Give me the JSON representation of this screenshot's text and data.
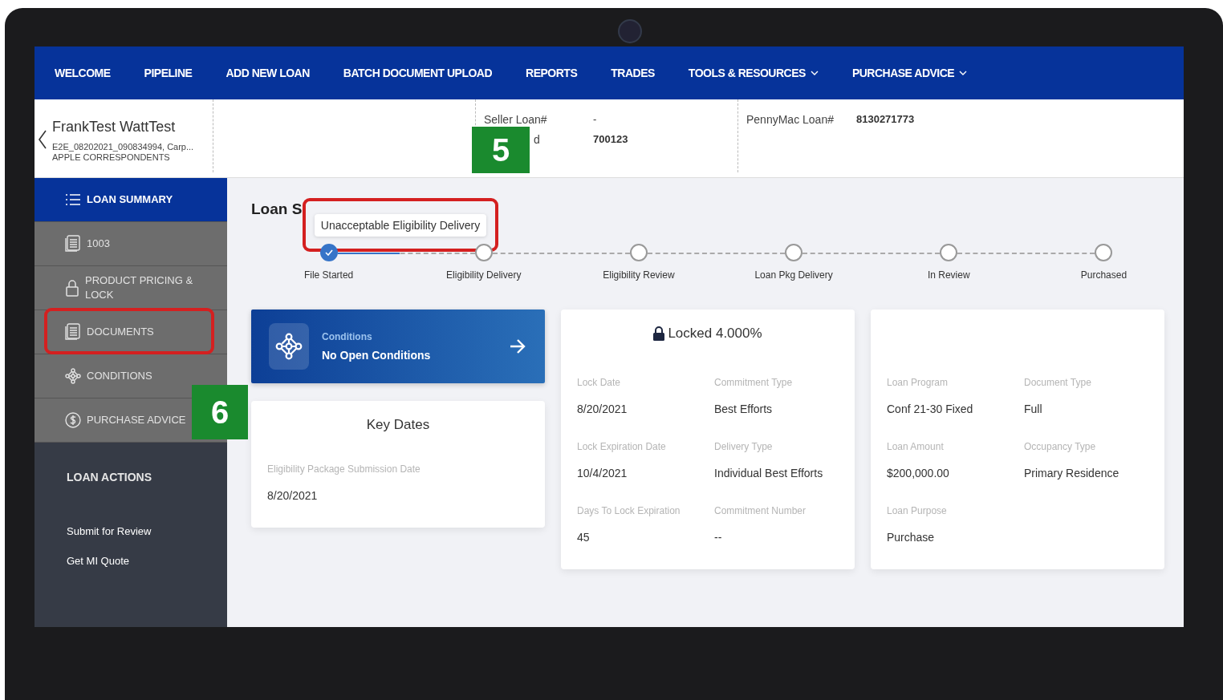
{
  "nav": {
    "items": [
      {
        "label": "WELCOME",
        "dropdown": false
      },
      {
        "label": "PIPELINE",
        "dropdown": false
      },
      {
        "label": "ADD NEW LOAN",
        "dropdown": false
      },
      {
        "label": "BATCH DOCUMENT UPLOAD",
        "dropdown": false
      },
      {
        "label": "REPORTS",
        "dropdown": false
      },
      {
        "label": "TRADES",
        "dropdown": false
      },
      {
        "label": "TOOLS & RESOURCES",
        "dropdown": true
      },
      {
        "label": "PURCHASE ADVICE",
        "dropdown": true
      }
    ]
  },
  "header": {
    "borrower": "FrankTest WattTest",
    "loan_line": "E2E_08202021_090834994, Carp...",
    "company": "APPLE CORRESPONDENTS",
    "fields": [
      {
        "label": "Seller Loan#",
        "value": "-"
      },
      {
        "label": "d",
        "value": "700123"
      }
    ],
    "pennymac": {
      "label": "PennyMac Loan#",
      "value": "8130271773"
    }
  },
  "sidebar": {
    "items": [
      {
        "label": "LOAN SUMMARY",
        "kind": "list",
        "selected": true,
        "highlighted": false
      },
      {
        "label": "1003",
        "kind": "doc",
        "selected": false,
        "highlighted": false
      },
      {
        "label": "PRODUCT PRICING & LOCK",
        "kind": "lock",
        "selected": false,
        "highlighted": false
      },
      {
        "label": "DOCUMENTS",
        "kind": "doc",
        "selected": false,
        "highlighted": true
      },
      {
        "label": "CONDITIONS",
        "kind": "network",
        "selected": false,
        "highlighted": false
      },
      {
        "label": "PURCHASE ADVICE",
        "kind": "dollar",
        "selected": false,
        "highlighted": false
      }
    ],
    "actions_title": "LOAN ACTIONS",
    "actions": [
      "Submit for Review",
      "Get MI Quote"
    ]
  },
  "main": {
    "title": "Loan S",
    "tooltip": "Unacceptable Eligibility Delivery",
    "steps": [
      {
        "label": "File Started",
        "completed": true
      },
      {
        "label": "Eligibility Delivery",
        "completed": false
      },
      {
        "label": "Eligibility Review",
        "completed": false
      },
      {
        "label": "Loan Pkg Delivery",
        "completed": false
      },
      {
        "label": "In Review",
        "completed": false
      },
      {
        "label": "Purchased",
        "completed": false
      }
    ],
    "conditions": {
      "label": "Conditions",
      "value": "No Open Conditions"
    },
    "key_dates": {
      "title": "Key Dates",
      "fields": [
        {
          "label": "Eligibility Package Submission Date",
          "value": "8/20/2021"
        }
      ]
    },
    "lock_card": {
      "status": "Locked 4.000%",
      "fields": [
        {
          "label": "Lock Date",
          "value": "8/20/2021"
        },
        {
          "label": "Commitment Type",
          "value": "Best Efforts"
        },
        {
          "label": "Lock Expiration Date",
          "value": "10/4/2021"
        },
        {
          "label": "Delivery Type",
          "value": "Individual Best Efforts"
        },
        {
          "label": "Days To Lock Expiration",
          "value": "45"
        },
        {
          "label": "Commitment Number",
          "value": "--"
        }
      ]
    },
    "loan_card": {
      "fields": [
        {
          "label": "Loan Program",
          "value": "Conf 21-30 Fixed"
        },
        {
          "label": "Document Type",
          "value": "Full"
        },
        {
          "label": "Loan Amount",
          "value": "$200,000.00"
        },
        {
          "label": "Occupancy Type",
          "value": "Primary Residence"
        },
        {
          "label": "Loan Purpose",
          "value": "Purchase"
        }
      ]
    }
  },
  "callouts": [
    "5",
    "6"
  ]
}
